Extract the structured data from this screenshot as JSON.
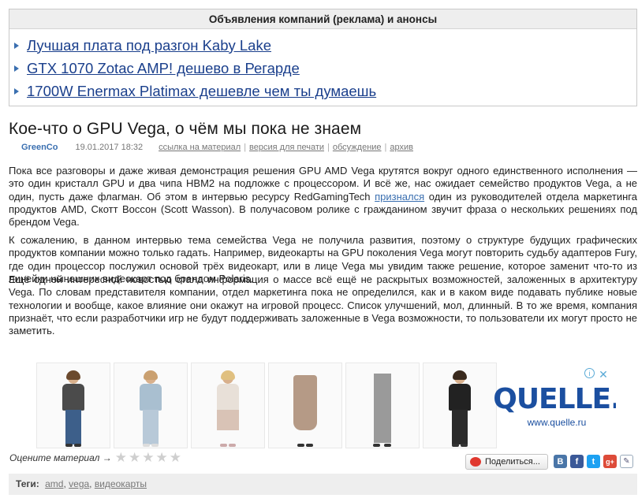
{
  "ads": {
    "header": "Объявления компаний (реклама) и анонсы",
    "links": [
      "Лучшая плата под разгон Kaby Lake",
      "GTX 1070 Zotac AMP! дешево в Регарде",
      "1700W Enermax Platimax дешевле чем ты думаешь"
    ]
  },
  "article": {
    "title": "Кое-что о GPU Vega, о чём мы пока не знаем",
    "author": "GreenCo",
    "date": "19.01.2017 18:32",
    "meta_links": [
      "ссылка на материал",
      "версия для печати",
      "обсуждение",
      "архив"
    ],
    "p1_a": "Пока все разговоры и даже живая демонстрация решения GPU AMD Vega крутятся вокруг одного единственного исполнения — это один кристалл GPU и два чипа HBM2 на подложке с процессором. И всё же, нас ожидает семейство продуктов Vega, а не один, пусть даже флагман. Об этом в интервью ресурсу RedGamingTech ",
    "p1_link": "признался",
    "p1_b": " один из руководителей отдела маркетинга продуктов AMD, Скотт Воссон (Scott Wasson). В получасовом ролике с гражданином звучит фраза о нескольких решениях под брендом Vega.",
    "p2": "К сожалению, в данном интервью тема семейства Vega не получила развития, поэтому о структуре будущих графических продуктов компании можно только гадать. Например, видеокарты на GPU поколения Vega могут повторить судьбу адаптеров Fury, где один процессор послужил основой трёх видеокарт, или в лице Vega мы увидим также решение, которое заменит что-то из линейки нынешних видеокарт под брендом Polaris.",
    "p3": "Ещё одной интересной новостью стала информация о массе всё ещё не раскрытых возможностей, заложенных в архитектуру Vega. По словам представителя компании, отдел маркетинга пока не определился, как и в каком виде подавать публике новые технологии и вообще, какое влияние они окажут на игровой процесс. Список улучшений, мол, длинный. В то же время, компания признаёт, что если разработчики игр не будут поддерживать заложенные в Vega возможности, то пользователи их могут просто не заметить."
  },
  "banner": {
    "brand": "QUELLE.",
    "url": "www.quelle.ru",
    "info_icon": "i",
    "close_icon": "✕"
  },
  "rating": {
    "label": "Оцените материал →",
    "star": "★"
  },
  "share": {
    "label": "Поделиться...",
    "networks": [
      {
        "label": "В",
        "color": "#4a76a8"
      },
      {
        "label": "f",
        "color": "#3b5998"
      },
      {
        "label": "t",
        "color": "#1da1f2"
      },
      {
        "label": "g+",
        "color": "#dd4b39"
      }
    ]
  },
  "tags": {
    "label": "Теги:",
    "items": [
      "amd",
      "vega",
      "видеокарты"
    ]
  },
  "colors": {
    "link": "#1a3f8c",
    "accent": "#3a6fb0",
    "quelle": "#1b4fa0"
  }
}
